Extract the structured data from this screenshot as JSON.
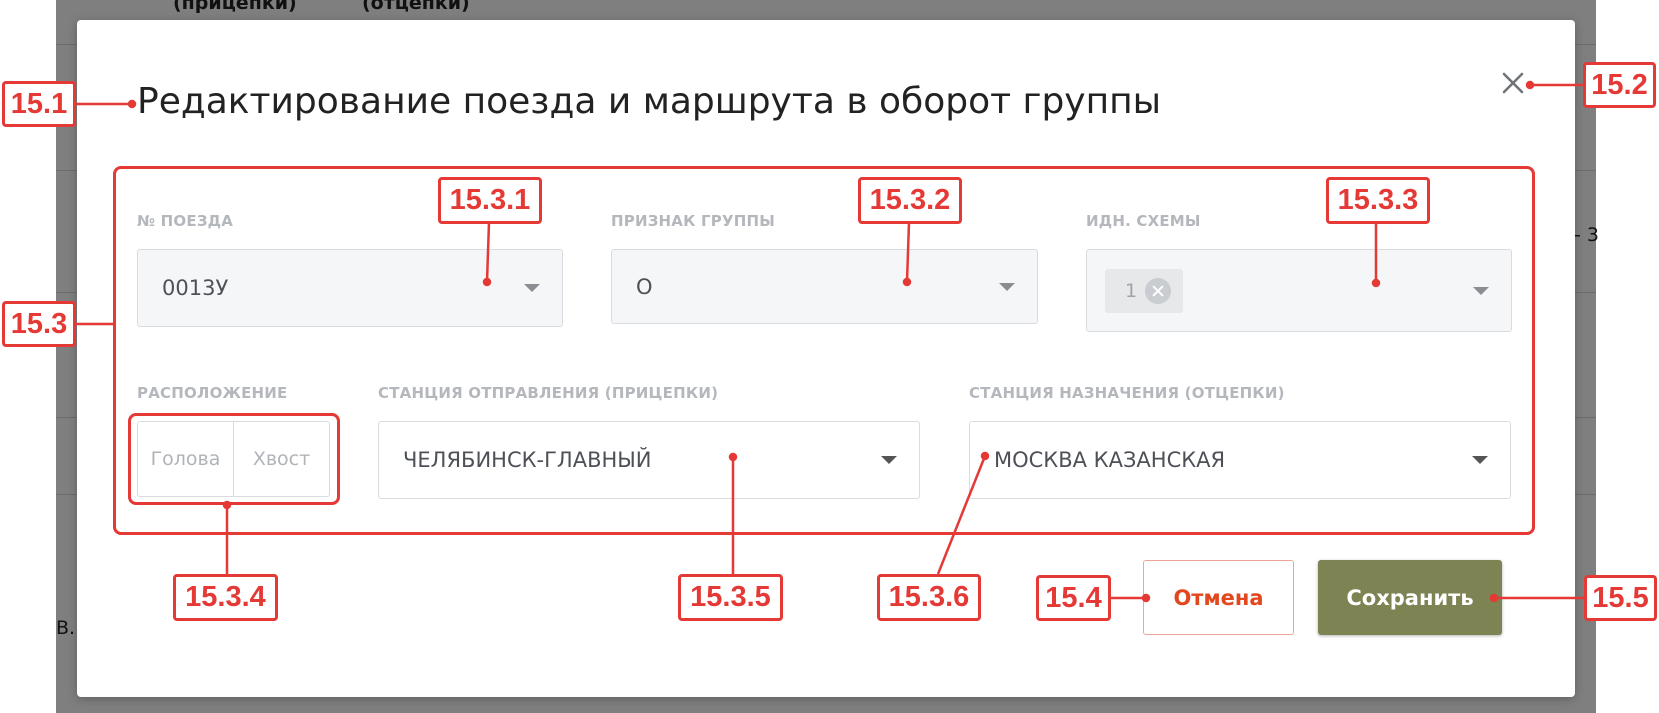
{
  "background": {
    "col_header_1": "(прицепки)",
    "col_header_2": "(отцепки)",
    "side_fragment_right": "- 3",
    "side_fragment_left": "В."
  },
  "modal": {
    "title": "Редактирование поезда и маршрута в оборот группы",
    "close_icon": "close-icon",
    "fields": {
      "train_number": {
        "label": "№ ПОЕЗДА",
        "value": "0013У"
      },
      "group_sign": {
        "label": "ПРИЗНАК ГРУППЫ",
        "value": "О"
      },
      "scheme_id": {
        "label": "ИДН. СХЕМЫ",
        "tag": "1",
        "tag_remove_icon": "remove-tag-icon"
      },
      "position": {
        "label": "РАСПОЛОЖЕНИЕ",
        "options": [
          "Голова",
          "Хвост"
        ]
      },
      "departure_station": {
        "label": "СТАНЦИЯ ОТПРАВЛЕНИЯ (ПРИЦЕПКИ)",
        "value": "ЧЕЛЯБИНСК-ГЛАВНЫЙ"
      },
      "destination_station": {
        "label": "СТАНЦИЯ НАЗНАЧЕНИЯ (ОТЦЕПКИ)",
        "value": "МОСКВА КАЗАНСКАЯ"
      }
    },
    "buttons": {
      "cancel": "Отмена",
      "save": "Сохранить"
    }
  },
  "annotations": {
    "title": "15.1",
    "close": "15.2",
    "form": "15.3",
    "train_number": "15.3.1",
    "group_sign": "15.3.2",
    "scheme_id": "15.3.3",
    "position": "15.3.4",
    "departure_station": "15.3.5",
    "destination_station": "15.3.6",
    "cancel": "15.4",
    "save": "15.5"
  },
  "colors": {
    "annotation": "#e53935",
    "save_button": "#7d8352",
    "cancel_text": "#e2471d",
    "label": "#b4b7bc"
  }
}
